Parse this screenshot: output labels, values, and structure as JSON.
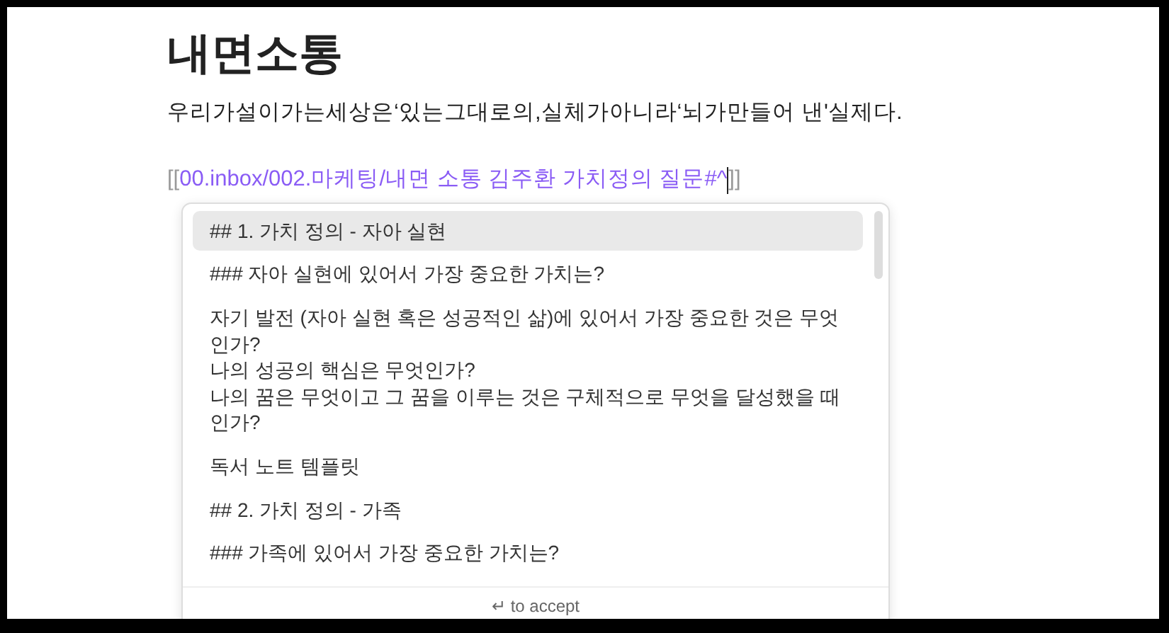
{
  "note": {
    "title": "내면소통",
    "paragraph": "우리가설이가는세상은‘있는그대로의,실체가아니라‘뇌가만들어 낸'실제다.",
    "link": {
      "open": "[[",
      "target": "00.inbox/002.마케팅/내면 소통 김주환 가치정의 질문#^",
      "close": "]]"
    }
  },
  "suggestions": {
    "items": [
      {
        "lines": [
          "## 1. 가치 정의 - 자아 실현"
        ],
        "selected": true
      },
      {
        "lines": [
          "### 자아 실현에 있어서 가장 중요한 가치는?"
        ],
        "selected": false
      },
      {
        "lines": [
          "자기 발전 (자아 실현 혹은 성공적인 삶)에 있어서  가장 중요한 것은 무엇인가?",
          "나의 성공의 핵심은 무엇인가?",
          "나의 꿈은 무엇이고 그 꿈을 이루는 것은 구체적으로  무엇을 달성했을 때인가?"
        ],
        "selected": false
      },
      {
        "lines": [
          "독서 노트 템플릿"
        ],
        "selected": false
      },
      {
        "lines": [
          "## 2. 가치 정의 - 가족"
        ],
        "selected": false
      },
      {
        "lines": [
          "### 가족에 있어서 가장 중요한 가치는?"
        ],
        "selected": false
      }
    ],
    "footer": "↵ to accept"
  }
}
